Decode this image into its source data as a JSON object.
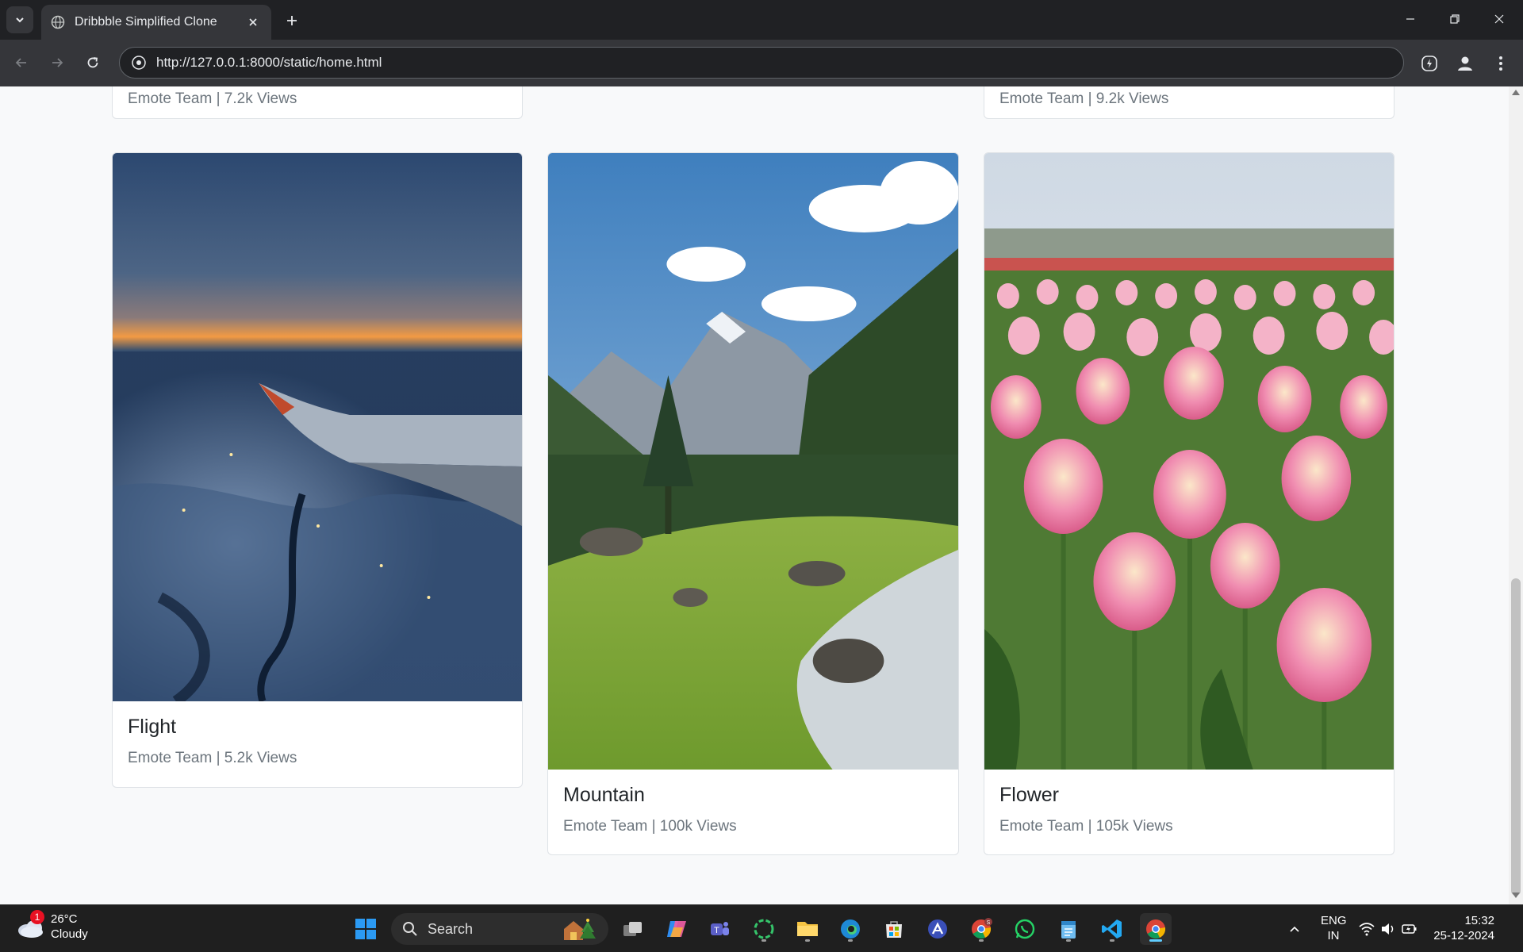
{
  "browser": {
    "tab_title": "Dribbble Simplified Clone",
    "url": "http://127.0.0.1:8000/static/home.html"
  },
  "top_row": [
    {
      "meta": "Emote Team | 7.2k Views"
    },
    {
      "meta": "Emote Team | 9.2k Views"
    }
  ],
  "cards": [
    {
      "title": "Flight",
      "meta": "Emote Team | 5.2k Views",
      "image": "airplane-wing-over-snowy-city-at-dusk"
    },
    {
      "title": "Mountain",
      "meta": "Emote Team | 100k Views",
      "image": "mountain-valley-with-stream"
    },
    {
      "title": "Flower",
      "meta": "Emote Team | 105k Views",
      "image": "pink-tulip-field"
    }
  ],
  "taskbar": {
    "weather_temp": "26°C",
    "weather_cond": "Cloudy",
    "weather_badge": "1",
    "search_label": "Search",
    "lang_top": "ENG",
    "lang_bottom": "IN",
    "time": "15:32",
    "date": "25-12-2024"
  },
  "colors": {
    "page_bg": "#f8f9fa",
    "card_border": "#dee2e6",
    "title_text": "#212529",
    "meta_text": "#6c757d",
    "chrome_dark": "#202124",
    "chrome_toolbar": "#35363a"
  }
}
